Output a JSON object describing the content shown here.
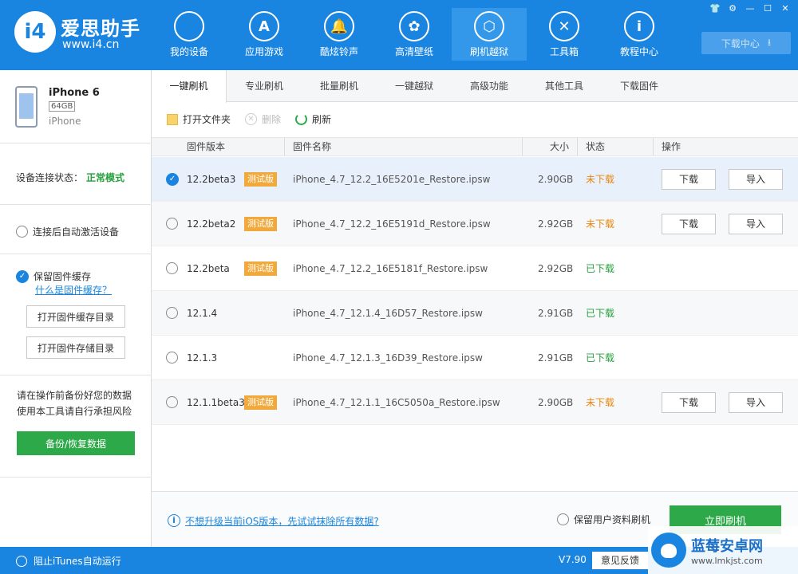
{
  "app": {
    "brand_name": "爱思助手",
    "brand_url": "www.i4.cn",
    "logo_text": "i4"
  },
  "nav": [
    {
      "label": "我的设备",
      "icon": "apple-icon"
    },
    {
      "label": "应用游戏",
      "icon": "app-store-icon"
    },
    {
      "label": "酷炫铃声",
      "icon": "bell-icon"
    },
    {
      "label": "高清壁纸",
      "icon": "flower-icon"
    },
    {
      "label": "刷机越狱",
      "icon": "dropbox-icon"
    },
    {
      "label": "工具箱",
      "icon": "tools-icon"
    },
    {
      "label": "教程中心",
      "icon": "info-icon"
    }
  ],
  "nav_glyphs": [
    "",
    "A",
    "🔔",
    "✿",
    "⬡",
    "✕",
    "i"
  ],
  "download_center": "下载中心",
  "window_buttons": [
    "👕",
    "⚙",
    "—",
    "☐",
    "✕"
  ],
  "device": {
    "name": "iPhone 6",
    "capacity": "64GB",
    "model": "iPhone"
  },
  "sidebar": {
    "status_label": "设备连接状态：",
    "status_value": "正常模式",
    "auto_activate": "连接后自动激活设备",
    "keep_cache": "保留固件缓存",
    "what_is_cache": "什么是固件缓存？",
    "open_cache_dir": "打开固件缓存目录",
    "open_storage_dir": "打开固件存储目录",
    "warning_line1": "请在操作前备份好您的数据",
    "warning_line2": "使用本工具请自行承担风险",
    "backup_button": "备份/恢复数据"
  },
  "tabs": [
    "一键刷机",
    "专业刷机",
    "批量刷机",
    "一键越狱",
    "高级功能",
    "其他工具",
    "下载固件"
  ],
  "toolbar": {
    "open_folder": "打开文件夹",
    "delete": "删除",
    "refresh": "刷新"
  },
  "table": {
    "headers": {
      "version": "固件版本",
      "name": "固件名称",
      "size": "大小",
      "status": "状态",
      "action": "操作"
    },
    "rows": [
      {
        "version": "12.2beta3",
        "badge": "测试版",
        "name": "iPhone_4.7_12.2_16E5201e_Restore.ipsw",
        "size": "2.90GB",
        "status": "未下载",
        "selected": true,
        "download": "下载",
        "import": "导入"
      },
      {
        "version": "12.2beta2",
        "badge": "测试版",
        "name": "iPhone_4.7_12.2_16E5191d_Restore.ipsw",
        "size": "2.92GB",
        "status": "未下载",
        "selected": false,
        "download": "下载",
        "import": "导入"
      },
      {
        "version": "12.2beta",
        "badge": "测试版",
        "name": "iPhone_4.7_12.2_16E5181f_Restore.ipsw",
        "size": "2.92GB",
        "status": "已下载",
        "selected": false
      },
      {
        "version": "12.1.4",
        "badge": "",
        "name": "iPhone_4.7_12.1.4_16D57_Restore.ipsw",
        "size": "2.91GB",
        "status": "已下载",
        "selected": false
      },
      {
        "version": "12.1.3",
        "badge": "",
        "name": "iPhone_4.7_12.1.3_16D39_Restore.ipsw",
        "size": "2.91GB",
        "status": "已下载",
        "selected": false
      },
      {
        "version": "12.1.1beta3",
        "badge": "测试版",
        "name": "iPhone_4.7_12.1.1_16C5050a_Restore.ipsw",
        "size": "2.90GB",
        "status": "未下载",
        "selected": false,
        "download": "下载",
        "import": "导入"
      }
    ]
  },
  "footer": {
    "info_link": "不想升级当前iOS版本，先试试抹除所有数据?",
    "keep_data": "保留用户资料刷机",
    "flash_button": "立即刷机"
  },
  "statusbar": {
    "block_itunes": "阻止iTunes自动运行",
    "version": "V7.90",
    "feedback": "意见反馈"
  },
  "watermark": {
    "title": "蓝莓安卓网",
    "url": "www.lmkjst.com"
  },
  "colors": {
    "brand_blue": "#1a85e0",
    "green": "#2ea94a",
    "orange_pending": "#e8870f",
    "badge_orange": "#f2a93b"
  }
}
